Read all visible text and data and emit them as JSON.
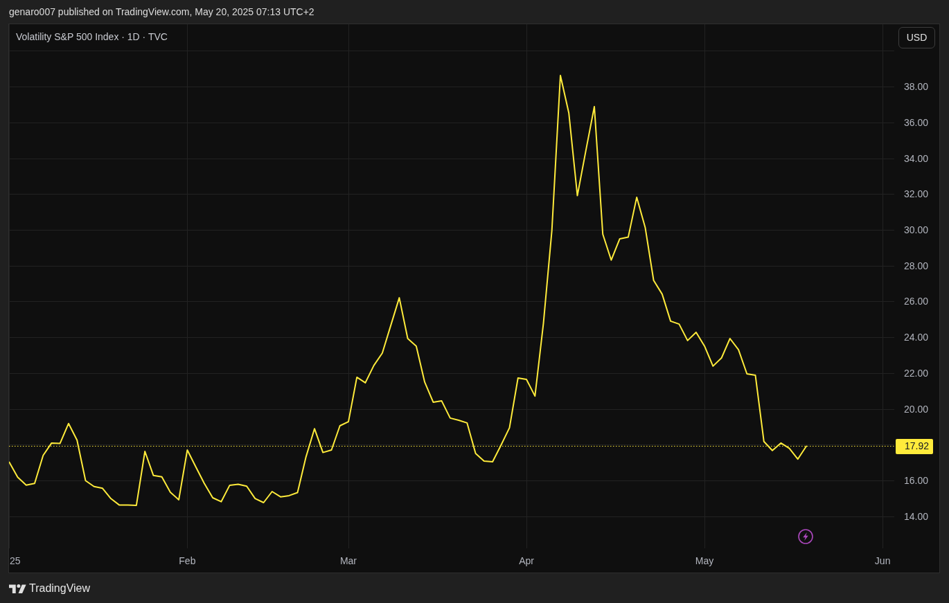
{
  "header": {
    "attribution": "genaro007 published on TradingView.com, May 20, 2025 07:13 UTC+2"
  },
  "chart": {
    "currency_button": {
      "label": "USD"
    },
    "chart_data": {
      "type": "line",
      "title": "Volatility S&P 500 Index · 1D · TVC",
      "grid": true,
      "categories": [
        "25",
        null,
        null,
        null,
        null,
        null,
        null,
        null,
        null,
        null,
        null,
        null,
        null,
        null,
        null,
        null,
        null,
        null,
        null,
        null,
        null,
        "Feb",
        null,
        null,
        null,
        null,
        null,
        null,
        null,
        null,
        null,
        null,
        null,
        null,
        null,
        null,
        null,
        null,
        null,
        null,
        "Mar",
        null,
        null,
        null,
        null,
        null,
        null,
        null,
        null,
        null,
        null,
        null,
        null,
        null,
        null,
        null,
        null,
        null,
        null,
        null,
        null,
        "Apr",
        null,
        null,
        null,
        null,
        null,
        null,
        null,
        null,
        null,
        null,
        null,
        null,
        null,
        null,
        null,
        null,
        null,
        null,
        null,
        null,
        "May",
        null,
        null,
        null,
        null,
        null,
        null,
        null,
        null,
        null,
        null,
        null,
        null,
        null,
        null,
        null,
        null,
        null,
        null,
        null,
        null,
        "Jun"
      ],
      "series": [
        {
          "color": "#ffeb3b",
          "values": [
            17.03,
            16.19,
            15.75,
            15.84,
            17.41,
            18.1,
            18.08,
            19.19,
            18.26,
            16.0,
            15.67,
            15.57,
            14.99,
            14.63,
            14.63,
            14.62,
            17.63,
            16.29,
            16.21,
            15.35,
            14.93,
            17.71,
            16.77,
            15.84,
            15.04,
            14.82,
            15.74,
            15.8,
            15.69,
            15.0,
            14.77,
            15.39,
            15.09,
            15.16,
            15.33,
            17.32,
            18.9,
            17.57,
            17.71,
            19.06,
            19.29,
            21.77,
            21.46,
            22.43,
            23.12,
            24.67,
            26.21,
            23.93,
            23.51,
            21.5,
            20.38,
            20.45,
            19.49,
            19.37,
            19.22,
            17.52,
            17.09,
            17.05,
            17.98,
            18.95,
            21.73,
            21.65,
            20.72,
            24.78,
            29.97,
            38.62,
            36.52,
            31.91,
            34.41,
            36.88,
            29.76,
            28.31,
            29.5,
            29.59,
            31.82,
            30.14,
            27.18,
            26.41,
            24.9,
            24.74,
            23.82,
            24.28,
            23.51,
            22.39,
            22.85,
            23.93,
            23.31,
            21.96,
            21.88,
            18.18,
            17.68,
            18.1,
            17.8,
            17.2,
            17.92,
            null,
            null,
            null,
            null,
            null,
            null,
            null,
            null,
            null
          ]
        }
      ],
      "ylim": [
        12.22,
        41.48
      ],
      "yticks": [
        {
          "value": 14,
          "label": "14.00"
        },
        {
          "value": 16,
          "label": "16.00"
        },
        {
          "value": 20,
          "label": "20.00"
        },
        {
          "value": 22,
          "label": "22.00"
        },
        {
          "value": 24,
          "label": "24.00"
        },
        {
          "value": 26,
          "label": "26.00"
        },
        {
          "value": 28,
          "label": "28.00"
        },
        {
          "value": 30,
          "label": "30.00"
        },
        {
          "value": 32,
          "label": "32.00"
        },
        {
          "value": 34,
          "label": "34.00"
        },
        {
          "value": 36,
          "label": "36.00"
        },
        {
          "value": 38,
          "label": "38.00"
        }
      ],
      "ref_lines": [
        {
          "axis": "y",
          "value": 17.92,
          "label": "17.92"
        }
      ]
    }
  },
  "footer": {
    "brand": "TradingView"
  }
}
